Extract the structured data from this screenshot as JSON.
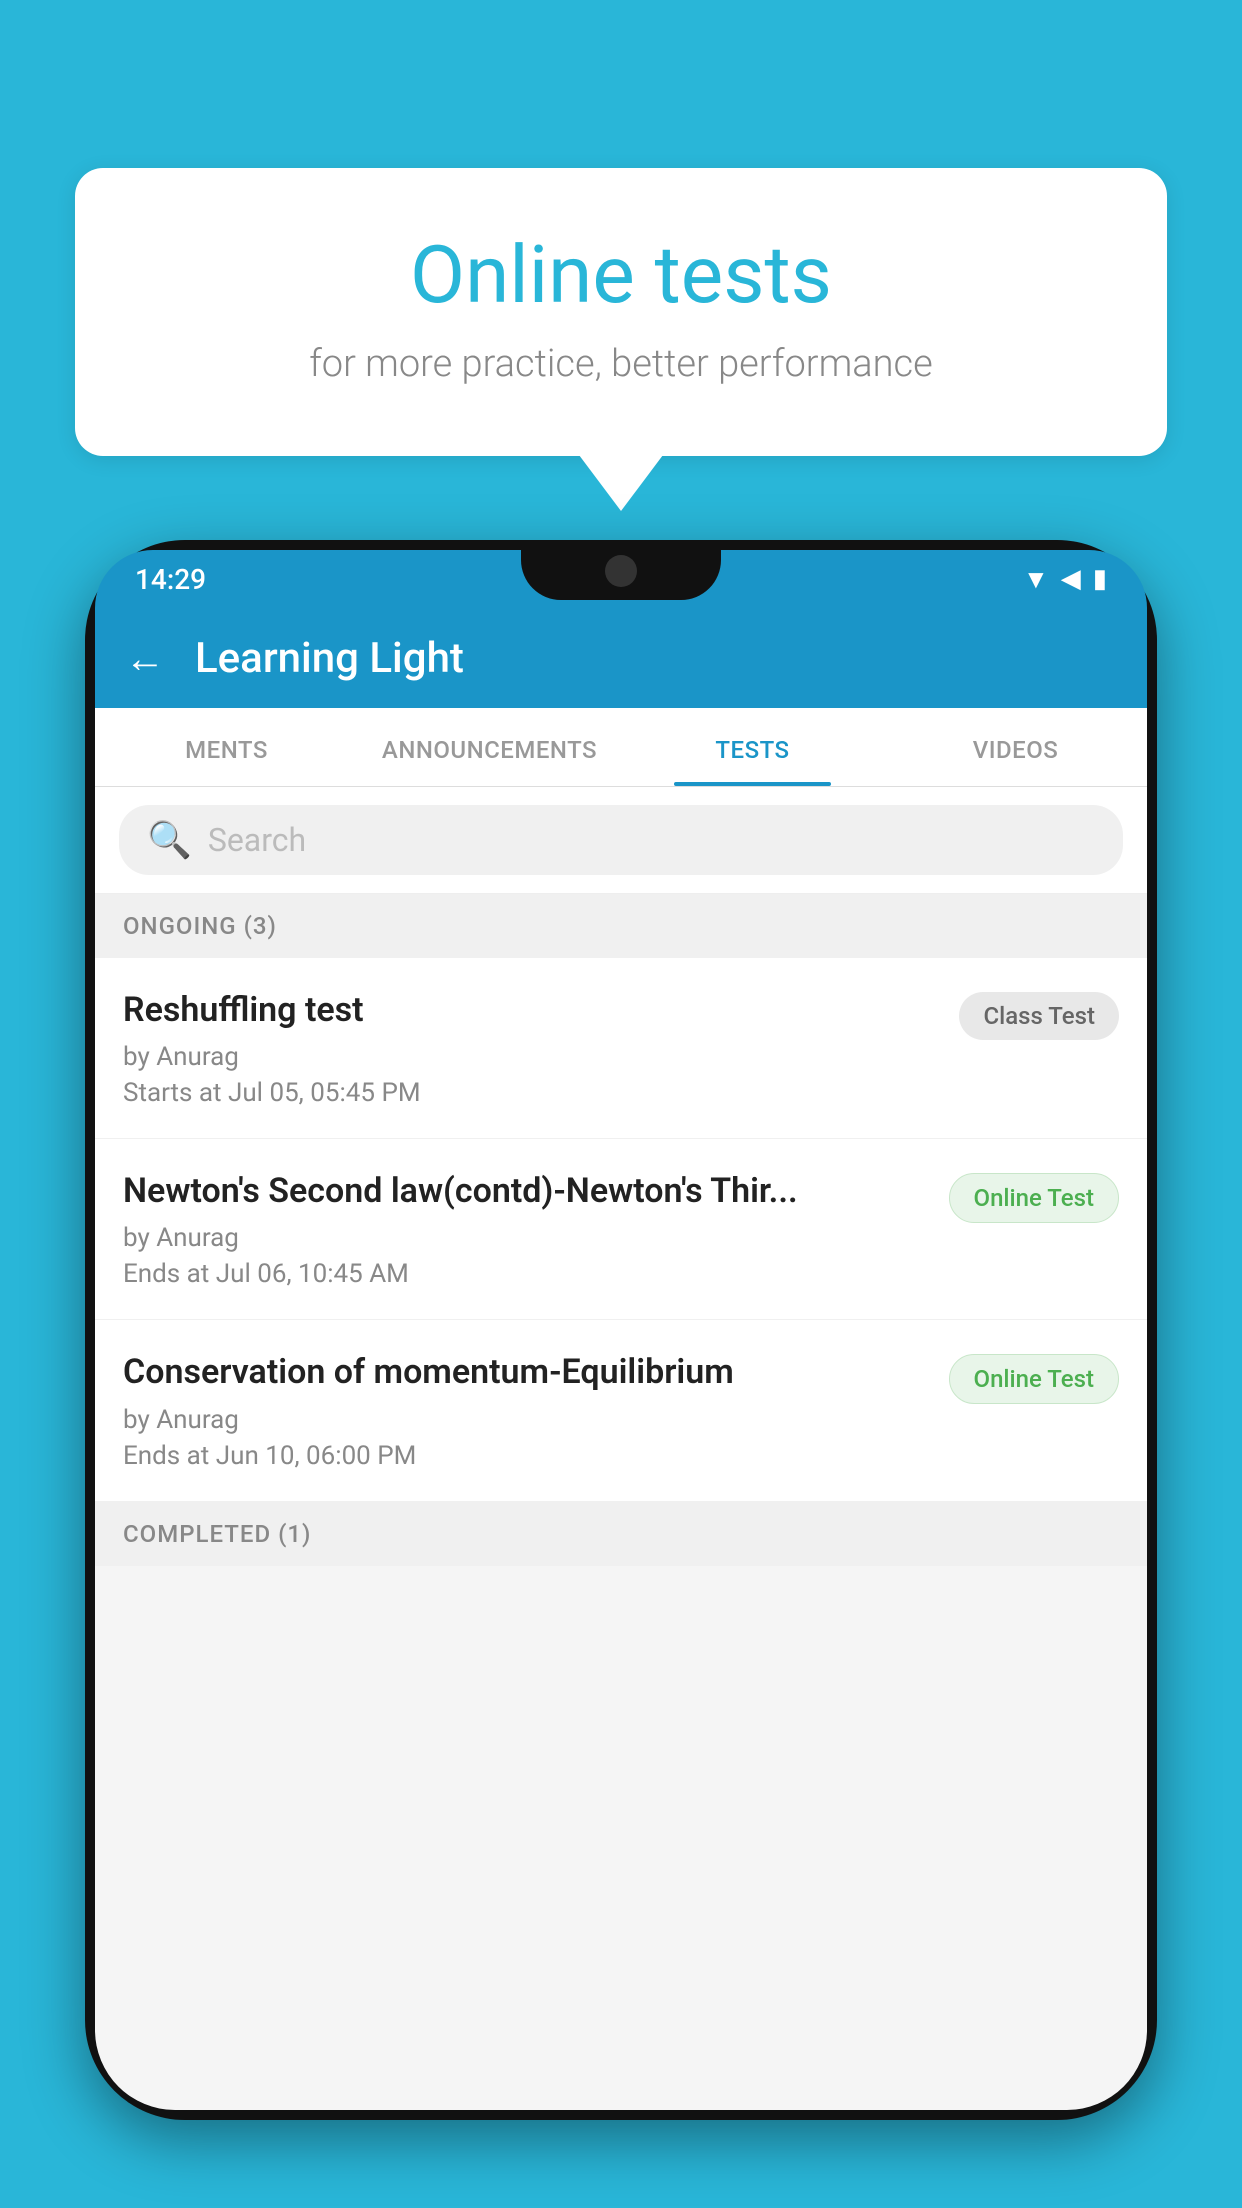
{
  "background_color": "#29b6d8",
  "speech_bubble": {
    "title": "Online tests",
    "subtitle": "for more practice, better performance"
  },
  "phone": {
    "status_bar": {
      "time": "14:29",
      "icons": [
        "wifi",
        "signal",
        "battery"
      ]
    },
    "app_header": {
      "title": "Learning Light",
      "back_label": "←"
    },
    "tabs": [
      {
        "label": "MENTS",
        "active": false
      },
      {
        "label": "ANNOUNCEMENTS",
        "active": false
      },
      {
        "label": "TESTS",
        "active": true
      },
      {
        "label": "VIDEOS",
        "active": false
      }
    ],
    "search": {
      "placeholder": "Search"
    },
    "ongoing_section": {
      "label": "ONGOING (3)"
    },
    "test_items": [
      {
        "name": "Reshuffling test",
        "author": "by Anurag",
        "time_label": "Starts at  Jul 05, 05:45 PM",
        "badge": "Class Test",
        "badge_type": "class"
      },
      {
        "name": "Newton's Second law(contd)-Newton's Thir...",
        "author": "by Anurag",
        "time_label": "Ends at  Jul 06, 10:45 AM",
        "badge": "Online Test",
        "badge_type": "online"
      },
      {
        "name": "Conservation of momentum-Equilibrium",
        "author": "by Anurag",
        "time_label": "Ends at  Jun 10, 06:00 PM",
        "badge": "Online Test",
        "badge_type": "online"
      }
    ],
    "completed_section": {
      "label": "COMPLETED (1)"
    }
  }
}
